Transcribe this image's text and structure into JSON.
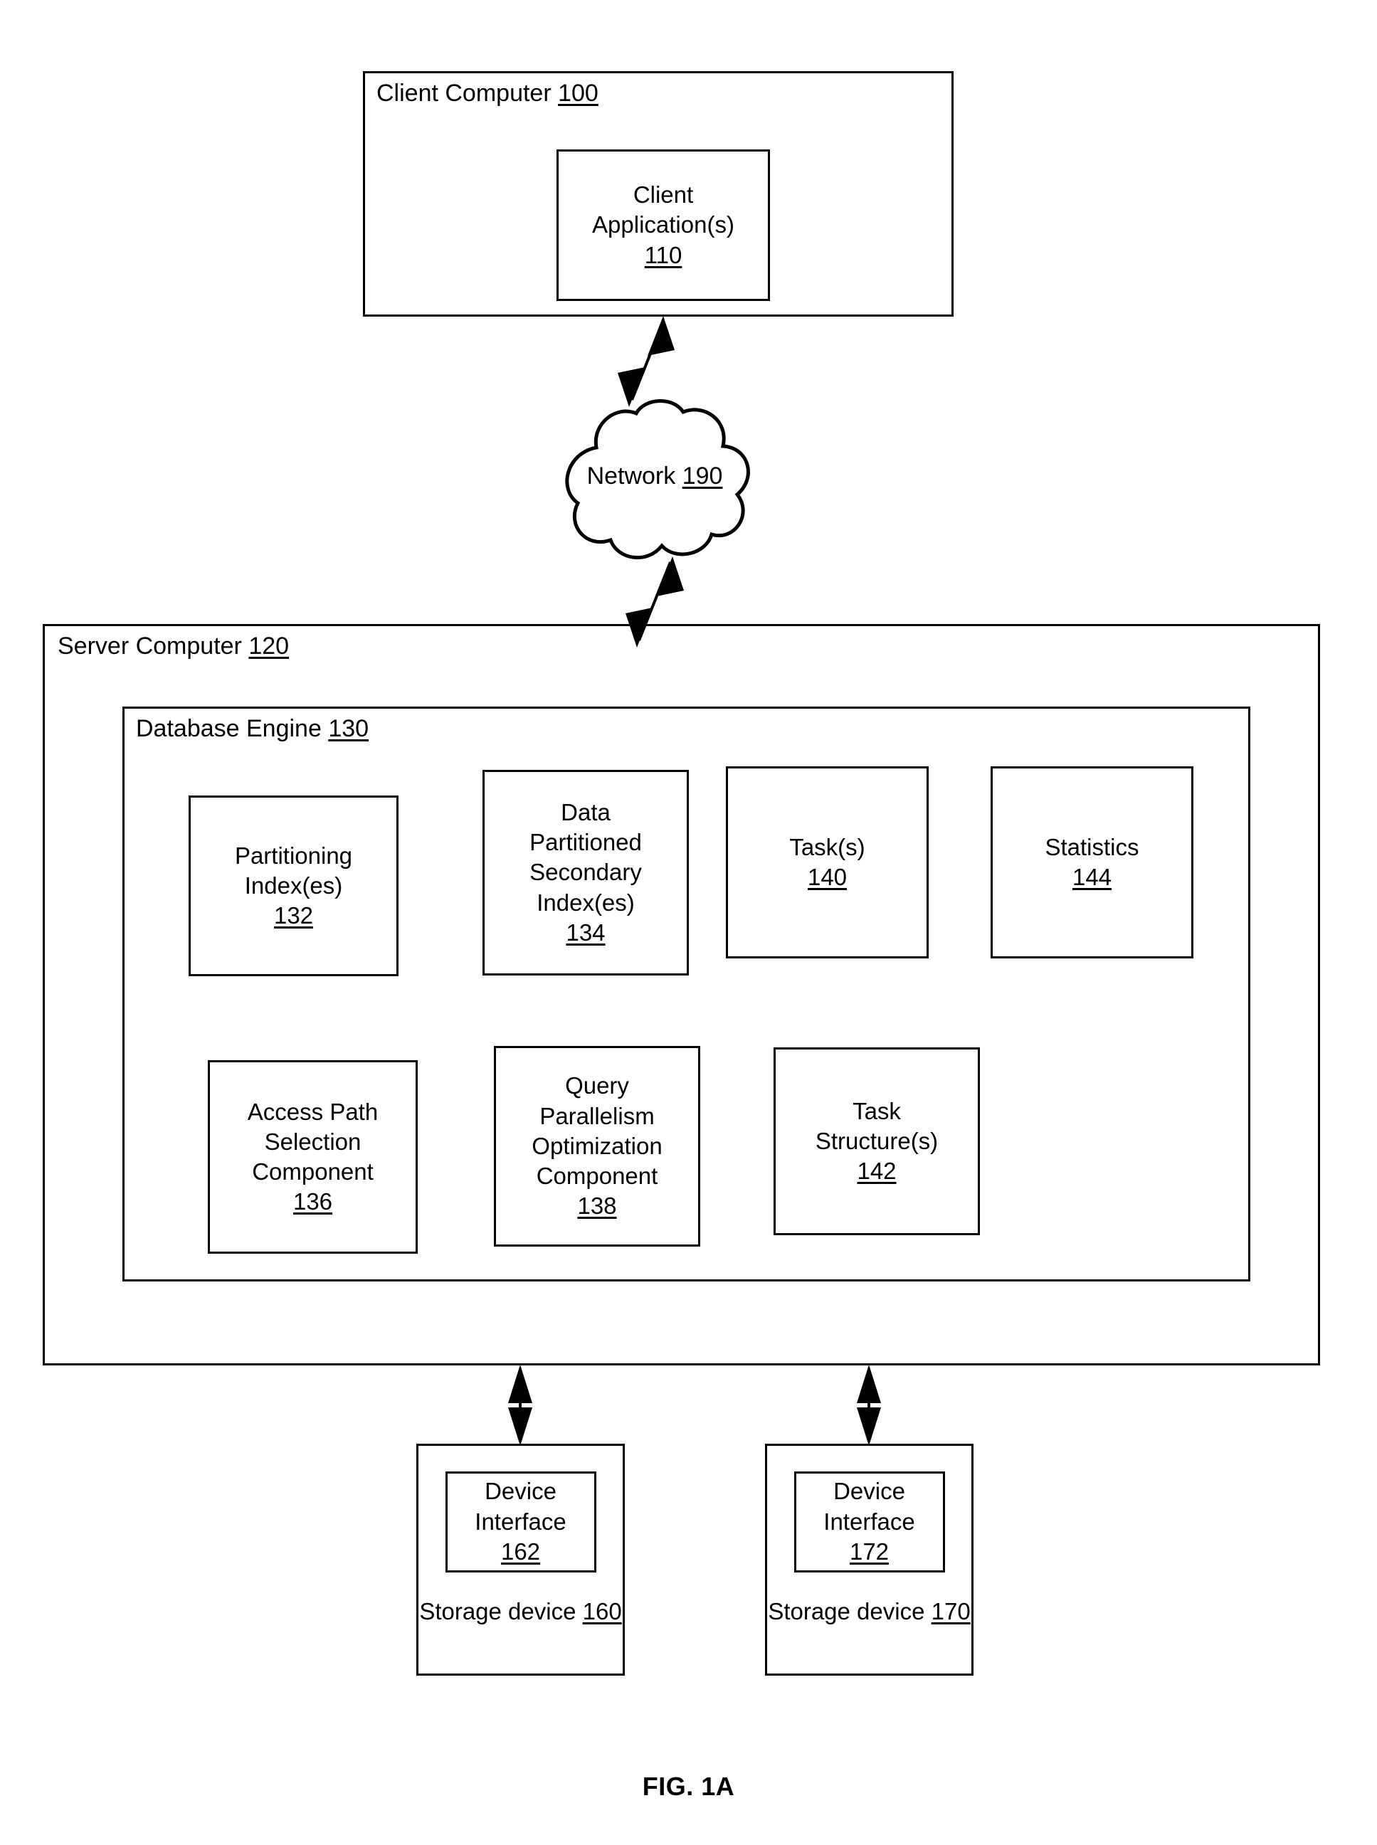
{
  "figure": {
    "caption": "FIG. 1A"
  },
  "client_computer": {
    "title_text": "Client Computer ",
    "title_ref": "100",
    "application": {
      "line1": "Client",
      "line2": "Application(s)",
      "ref": "110"
    }
  },
  "network": {
    "label_text": "Network ",
    "label_ref": "190"
  },
  "server_computer": {
    "title_text": "Server Computer ",
    "title_ref": "120",
    "database_engine": {
      "title_text": "Database Engine ",
      "title_ref": "130",
      "components": [
        {
          "name": "partitioning-index",
          "lines": [
            "Partitioning",
            "Index(es)"
          ],
          "ref": "132"
        },
        {
          "name": "data-partitioned-secondary-index",
          "lines": [
            "Data",
            "Partitioned",
            "Secondary",
            "Index(es)"
          ],
          "ref": "134"
        },
        {
          "name": "tasks",
          "lines": [
            "Task(s)"
          ],
          "ref": "140"
        },
        {
          "name": "statistics",
          "lines": [
            "Statistics"
          ],
          "ref": "144"
        },
        {
          "name": "access-path-selection-component",
          "lines": [
            "Access Path",
            "Selection",
            "Component"
          ],
          "ref": "136"
        },
        {
          "name": "query-parallelism-optimization-component",
          "lines": [
            "Query",
            "Parallelism",
            "Optimization",
            "Component"
          ],
          "ref": "138"
        },
        {
          "name": "task-structures",
          "lines": [
            "Task",
            "Structure(s)"
          ],
          "ref": "142"
        }
      ]
    }
  },
  "storage_devices": [
    {
      "interface_line1": "Device",
      "interface_line2": "Interface",
      "interface_ref": "162",
      "label": "Storage device",
      "ref": "160"
    },
    {
      "interface_line1": "Device",
      "interface_line2": "Interface",
      "interface_ref": "172",
      "label": "Storage device",
      "ref": "170"
    }
  ],
  "connectors": [
    {
      "name": "client-to-network-arrow",
      "style": "double-headed-diagonal"
    },
    {
      "name": "network-to-server-arrow",
      "style": "double-headed-diagonal"
    },
    {
      "name": "server-to-storage-160-arrow",
      "style": "double-headed-vertical"
    },
    {
      "name": "server-to-storage-170-arrow",
      "style": "double-headed-vertical"
    }
  ],
  "colors": {
    "stroke": "#000000",
    "background": "#ffffff"
  }
}
